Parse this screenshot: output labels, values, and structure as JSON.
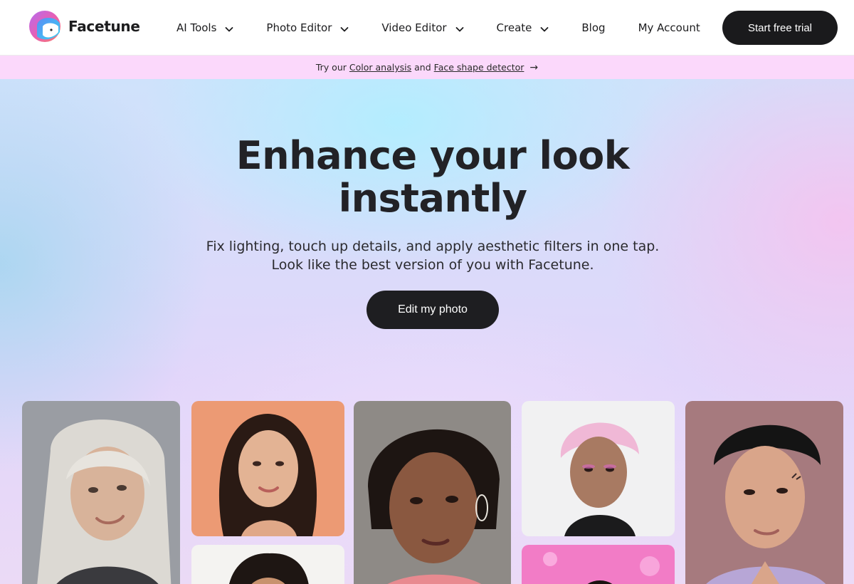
{
  "brand": {
    "name": "Facetune"
  },
  "nav": {
    "items": [
      {
        "label": "AI Tools",
        "has_dropdown": true
      },
      {
        "label": "Photo Editor",
        "has_dropdown": true
      },
      {
        "label": "Video Editor",
        "has_dropdown": true
      },
      {
        "label": "Create",
        "has_dropdown": true
      },
      {
        "label": "Blog",
        "has_dropdown": false
      },
      {
        "label": "My Account",
        "has_dropdown": false
      }
    ],
    "cta_label": "Start free trial"
  },
  "promo": {
    "prefix": "Try our",
    "link1": "Color analysis",
    "joiner": "and",
    "link2": "Face shape detector",
    "arrow": "→"
  },
  "hero": {
    "title_line1": "Enhance your look",
    "title_line2": "instantly",
    "subtitle_line1": "Fix lighting, touch up details, and apply aesthetic filters in one tap.",
    "subtitle_line2": "Look like the best version of you with Facetune.",
    "cta_label": "Edit my photo"
  },
  "icons": {
    "logo": "facetune-logo-icon",
    "dropdown": "chevron-down-icon",
    "arrow": "arrow-right-icon"
  },
  "colors": {
    "primary_dark": "#1a1a1c",
    "promo_bg": "#fbd8fb",
    "text": "#1c1c1e"
  }
}
